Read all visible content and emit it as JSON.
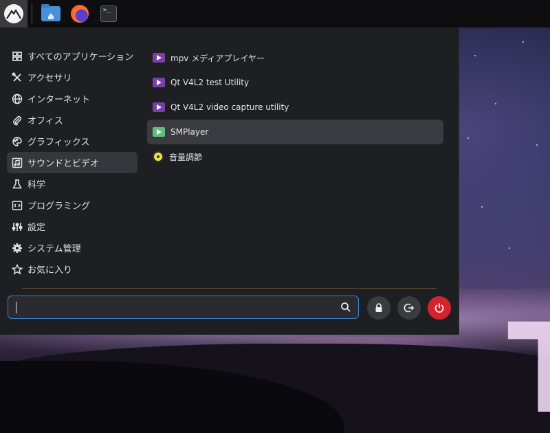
{
  "panel": {
    "launcher_icon": "cinnamon-mountain-icon",
    "tasks": [
      {
        "name": "home-folder-icon"
      },
      {
        "name": "firefox-icon"
      },
      {
        "name": "terminal-icon",
        "glyph": ">_"
      }
    ]
  },
  "menu": {
    "categories": [
      {
        "label": "すべてのアプリケーション",
        "icon": "grid-icon"
      },
      {
        "label": "アクセサリ",
        "icon": "tools-icon"
      },
      {
        "label": "インターネット",
        "icon": "globe-icon"
      },
      {
        "label": "オフィス",
        "icon": "paperclip-icon"
      },
      {
        "label": "グラフィックス",
        "icon": "palette-icon"
      },
      {
        "label": "サウンドとビデオ",
        "icon": "media-icon",
        "active": true
      },
      {
        "label": "科学",
        "icon": "flask-icon"
      },
      {
        "label": "プログラミング",
        "icon": "code-icon"
      },
      {
        "label": "設定",
        "icon": "sliders-icon"
      },
      {
        "label": "システム管理",
        "icon": "gear-icon"
      },
      {
        "label": "お気に入り",
        "icon": "star-icon"
      }
    ],
    "apps": [
      {
        "label": "mpv メディアプレイヤー",
        "icon": "play-icon",
        "color": "#7b3fa8"
      },
      {
        "label": "Qt V4L2 test Utility",
        "icon": "play-icon",
        "color": "#7b3fa8"
      },
      {
        "label": "Qt V4L2 video capture utility",
        "icon": "play-icon",
        "color": "#7b3fa8"
      },
      {
        "label": "SMPlayer",
        "icon": "play-icon",
        "color": "#5fbf7a",
        "selected": true
      },
      {
        "label": "音量調節",
        "icon": "volume-icon",
        "color": "#f2e04a"
      }
    ],
    "search": {
      "value": "",
      "placeholder": ""
    },
    "actions": [
      {
        "name": "lock-button",
        "icon": "lock-icon"
      },
      {
        "name": "logout-button",
        "icon": "logout-icon"
      },
      {
        "name": "power-button",
        "icon": "power-icon",
        "color": "#d3242e"
      }
    ]
  },
  "wallpaper": {
    "text": "T"
  }
}
